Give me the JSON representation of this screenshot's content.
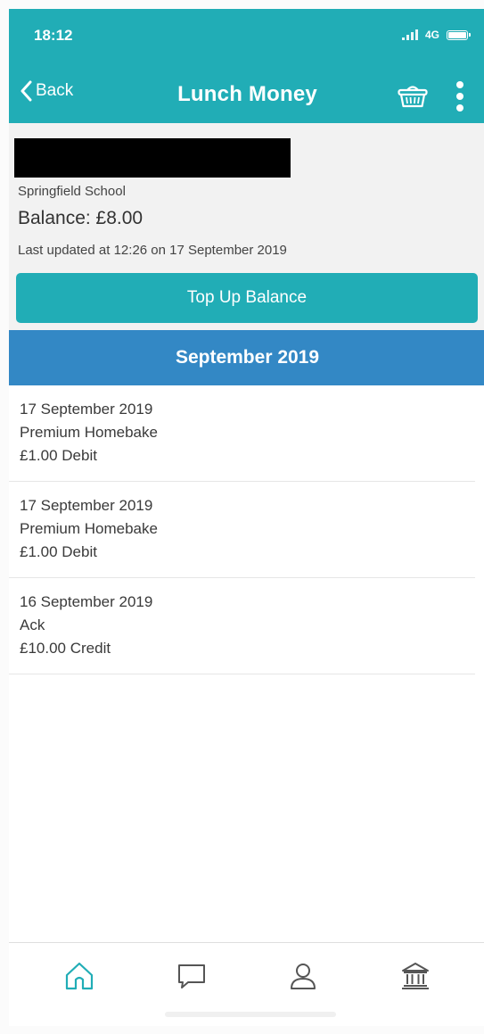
{
  "status_bar": {
    "time": "18:12",
    "network": "4G"
  },
  "nav": {
    "back_label": "Back",
    "title": "Lunch Money"
  },
  "account": {
    "school": "Springfield School",
    "balance": "Balance: £8.00",
    "last_updated": "Last updated at 12:26 on 17 September 2019",
    "topup_label": "Top Up Balance"
  },
  "month_header": "September 2019",
  "transactions": [
    {
      "date": "17 September 2019",
      "description": "Premium Homebake",
      "amount": "£1.00 Debit"
    },
    {
      "date": "17 September 2019",
      "description": "Premium Homebake",
      "amount": "£1.00 Debit"
    },
    {
      "date": "16 September 2019",
      "description": "Ack",
      "amount": "£10.00 Credit"
    }
  ],
  "tabs": [
    {
      "name": "home",
      "icon": "home-icon",
      "active": true
    },
    {
      "name": "messages",
      "icon": "chat-bubble-icon",
      "active": false
    },
    {
      "name": "profile",
      "icon": "person-icon",
      "active": false
    },
    {
      "name": "finance",
      "icon": "bank-icon",
      "active": false
    }
  ],
  "colors": {
    "header": "#21adb6",
    "month_header": "#3388c5",
    "active_tab": "#21adb6",
    "inactive_tab": "#555555"
  }
}
